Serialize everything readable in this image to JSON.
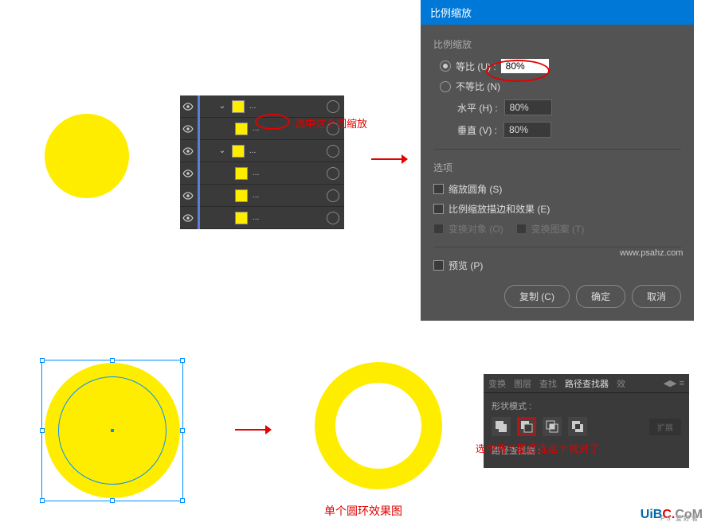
{
  "layers": {
    "dots": "..."
  },
  "callouts": {
    "select_circle": "选中这个圆缩放",
    "result": "单个圆环效果图",
    "pathfinder_hint": "选中两个圆后选这个就对了"
  },
  "dialog": {
    "title": "比例缩放",
    "group_scale": "比例缩放",
    "uniform": "等比 (U) :",
    "uniform_value": "80%",
    "non_uniform": "不等比 (N)",
    "horizontal": "水平 (H) :",
    "horizontal_value": "80%",
    "vertical": "垂直 (V) :",
    "vertical_value": "80%",
    "options": "选项",
    "scale_corners": "缩放圆角 (S)",
    "scale_strokes": "比例缩放描边和效果 (E)",
    "transform_objects": "变换对象 (O)",
    "transform_patterns": "变换图案 (T)",
    "preview": "预览 (P)",
    "copy": "复制 (C)",
    "ok": "确定",
    "cancel": "取消"
  },
  "pathfinder": {
    "tab1": "变换",
    "tab2": "图层",
    "tab3": "查找",
    "tab_active": "路径查找器",
    "tab5": "效",
    "shape_modes": "形状模式 :",
    "pathfinders": "路径查找器 :",
    "expand": "扩展"
  },
  "watermark": {
    "text1": "UiB",
    "text2": "C.",
    "text3": "CoM",
    "sub": "PS 爱好者"
  },
  "wm2": "www.psahz.com"
}
